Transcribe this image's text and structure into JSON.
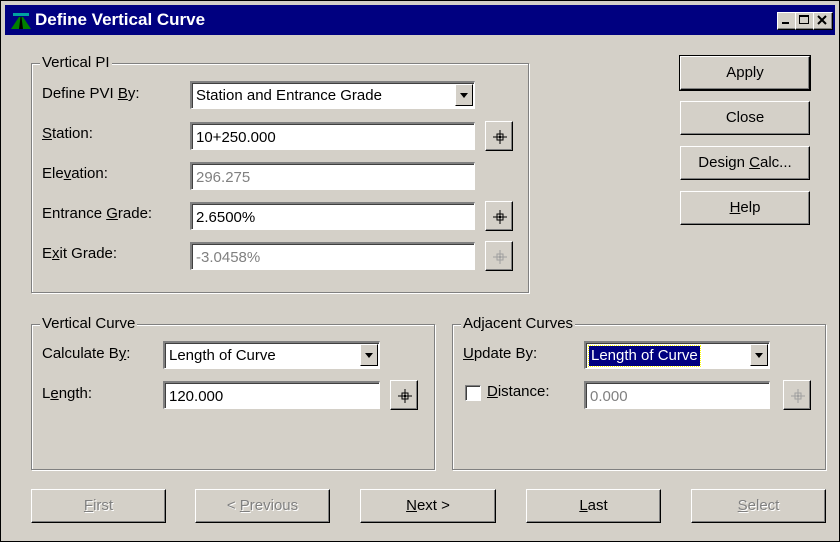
{
  "window": {
    "title": "Define Vertical Curve"
  },
  "vertical_pi": {
    "legend": "Vertical PI",
    "define_pvi_by": {
      "label_pre": "Define PVI ",
      "label_u": "B",
      "label_post": "y:",
      "value": "Station and Entrance Grade"
    },
    "station": {
      "label_pre": "",
      "label_u": "S",
      "label_post": "tation:",
      "value": "10+250.000"
    },
    "elevation": {
      "label_pre": "Ele",
      "label_u": "v",
      "label_post": "ation:",
      "value": "296.275"
    },
    "entrance_grade": {
      "label_pre": "Entrance ",
      "label_u": "G",
      "label_post": "rade:",
      "value": "2.6500%"
    },
    "exit_grade": {
      "label_pre": "E",
      "label_u": "x",
      "label_post": "it Grade:",
      "value": "-3.0458%"
    }
  },
  "vertical_curve": {
    "legend": "Vertical Curve",
    "calculate_by": {
      "label_pre": "Calculate B",
      "label_u": "y",
      "label_post": ":",
      "value": "Length of Curve"
    },
    "length": {
      "label_pre": "L",
      "label_u": "e",
      "label_post": "ngth:",
      "value": "120.000"
    }
  },
  "adjacent_curves": {
    "legend": "Adjacent Curves",
    "update_by": {
      "label_pre": "",
      "label_u": "U",
      "label_post": "pdate By:",
      "value": "Length of Curve"
    },
    "distance": {
      "label_pre": "",
      "label_u": "D",
      "label_post": "istance:",
      "value": "0.000",
      "checked": false
    }
  },
  "side_buttons": {
    "apply": "Apply",
    "close": "Close",
    "design_calc": {
      "pre": "Design ",
      "u": "C",
      "post": "alc..."
    },
    "help": {
      "pre": "",
      "u": "H",
      "post": "elp"
    }
  },
  "nav_buttons": {
    "first": {
      "pre": "",
      "u": "F",
      "post": "irst",
      "enabled": false
    },
    "previous": {
      "pre": "< ",
      "u": "P",
      "post": "revious",
      "enabled": false
    },
    "next": {
      "pre": "",
      "u": "N",
      "post": "ext >",
      "enabled": true
    },
    "last": {
      "pre": "",
      "u": "L",
      "post": "ast",
      "enabled": true
    },
    "select": {
      "pre": "",
      "u": "S",
      "post": "elect",
      "enabled": false
    }
  }
}
